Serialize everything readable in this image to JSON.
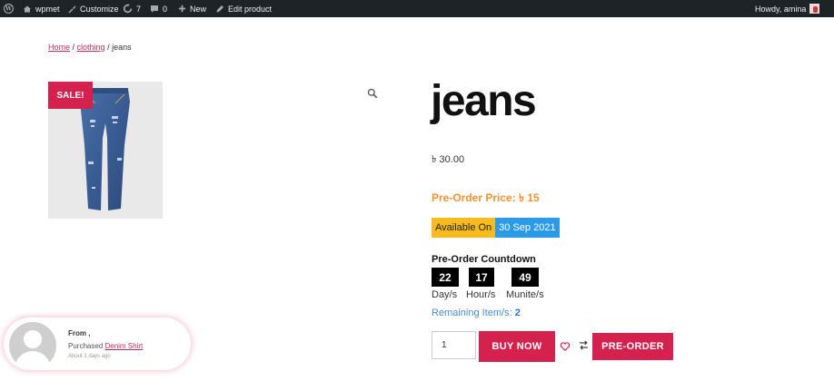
{
  "admin_bar": {
    "site_name": "wpmet",
    "customize": "Customize",
    "updates_count": "7",
    "comments_count": "0",
    "new_label": "New",
    "edit_product": "Edit product",
    "howdy": "Howdy, amina"
  },
  "breadcrumb": {
    "home": "Home",
    "sep1": " / ",
    "category": "clothing",
    "sep2": " / ",
    "current": "jeans"
  },
  "product": {
    "sale_badge": "SALE!",
    "title": "jeans",
    "price": "৳ 30.00",
    "preorder_price": "Pre-Order Price: ৳ 15",
    "available_label": "Available On",
    "available_date": "30 Sep 2021",
    "countdown_title": "Pre-Order Countdown",
    "countdown": [
      {
        "value": "22",
        "label": "Day/s"
      },
      {
        "value": "17",
        "label": "Hour/s"
      },
      {
        "value": "49",
        "label": "Munite/s"
      }
    ],
    "remaining_label": "Remaining Item/s: ",
    "remaining_count": "2",
    "quantity": "1",
    "buy_now": "BUY NOW",
    "pre_order": "PRE-ORDER"
  },
  "sales_popup": {
    "from": "From ,",
    "purchased_prefix": "Purchased ",
    "product_link": "Denim Shirt",
    "time": "About 1 days ago"
  },
  "colors": {
    "accent": "#d4214e",
    "preorder_orange": "#f39233",
    "available_yellow": "#f6bc1f",
    "available_blue": "#2b9be8",
    "admin_bar": "#1d2327"
  },
  "icons": [
    "wordpress-icon",
    "home-icon",
    "brush-icon",
    "refresh-icon",
    "comment-icon",
    "plus-icon",
    "pencil-icon",
    "search-zoom-icon",
    "heart-icon",
    "compare-icon"
  ]
}
